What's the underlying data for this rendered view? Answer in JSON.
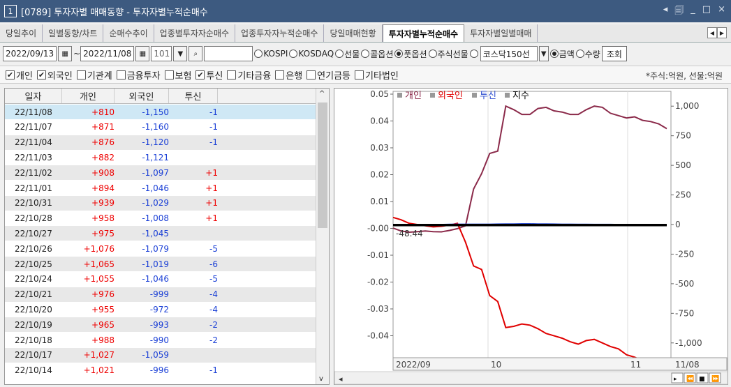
{
  "window": {
    "num": "1",
    "title": "[0789] 투자자별 매매동향 - 투자자별누적순매수",
    "controls": [
      "◂",
      "🗐",
      "_",
      "□",
      "×"
    ]
  },
  "tabs": [
    "당일추이",
    "일별동향/차트",
    "순매수추이",
    "업종별투자자순매수",
    "업종투자자누적순매수",
    "당일매매현황",
    "투자자별누적순매수",
    "투자자별일별매매"
  ],
  "active_tab": 6,
  "toolbar": {
    "date_from": "2022/09/13",
    "sep": "~",
    "date_to": "2022/11/08",
    "code": "101",
    "market_options": [
      "KOSPI",
      "KOSDAQ",
      "선물",
      "콜옵션",
      "풋옵션",
      "주식선물"
    ],
    "selected_market": "풋옵션",
    "index_select": "코스닥150선",
    "unit_options": [
      "금액",
      "수량"
    ],
    "selected_unit": "금액",
    "query_button": "조회"
  },
  "checks": [
    {
      "label": "개인",
      "on": true
    },
    {
      "label": "외국인",
      "on": true
    },
    {
      "label": "기관계",
      "on": false
    },
    {
      "label": "금융투자",
      "on": false
    },
    {
      "label": "보험",
      "on": false
    },
    {
      "label": "투신",
      "on": true
    },
    {
      "label": "기타금융",
      "on": false
    },
    {
      "label": "은행",
      "on": false
    },
    {
      "label": "연기금등",
      "on": false
    },
    {
      "label": "기타법인",
      "on": false
    }
  ],
  "unit_note": "*주식:억원, 선물:억원",
  "table": {
    "headers": [
      "일자",
      "개인",
      "외국인",
      "투신"
    ],
    "rows": [
      [
        "22/11/08",
        "+810",
        "-1,150",
        "-1"
      ],
      [
        "22/11/07",
        "+871",
        "-1,160",
        "-1"
      ],
      [
        "22/11/04",
        "+876",
        "-1,120",
        "-1"
      ],
      [
        "22/11/03",
        "+882",
        "-1,121",
        ""
      ],
      [
        "22/11/02",
        "+908",
        "-1,097",
        "+1"
      ],
      [
        "22/11/01",
        "+894",
        "-1,046",
        "+1"
      ],
      [
        "22/10/31",
        "+939",
        "-1,029",
        "+1"
      ],
      [
        "22/10/28",
        "+958",
        "-1,008",
        "+1"
      ],
      [
        "22/10/27",
        "+975",
        "-1,045",
        ""
      ],
      [
        "22/10/26",
        "+1,076",
        "-1,079",
        "-5"
      ],
      [
        "22/10/25",
        "+1,065",
        "-1,019",
        "-6"
      ],
      [
        "22/10/24",
        "+1,055",
        "-1,046",
        "-5"
      ],
      [
        "22/10/21",
        "+976",
        "-999",
        "-4"
      ],
      [
        "22/10/20",
        "+955",
        "-972",
        "-4"
      ],
      [
        "22/10/19",
        "+965",
        "-993",
        "-2"
      ],
      [
        "22/10/18",
        "+988",
        "-990",
        "-2"
      ],
      [
        "22/10/17",
        "+1,027",
        "-1,059",
        ""
      ],
      [
        "22/10/14",
        "+1,021",
        "-996",
        "-1"
      ]
    ]
  },
  "chart_data": {
    "type": "line",
    "legend": [
      "개인",
      "외국인",
      "투신",
      "지수"
    ],
    "legend_colors": [
      "#8b2a4a",
      "#e00000",
      "#3050d0",
      "#000000"
    ],
    "left_ticks": [
      "0.05",
      "0.04",
      "0.03",
      "0.02",
      "0.01",
      "-0.00",
      "-0.01",
      "-0.02",
      "-0.03",
      "-0.04"
    ],
    "right_ticks": [
      "1,000",
      "750",
      "500",
      "250",
      "0",
      "-250",
      "-500",
      "-750",
      "-1,000"
    ],
    "x_labels": [
      "2022/09",
      "10",
      "11",
      "11/08"
    ],
    "annotation": "-48.44",
    "ylim_right": [
      -1125,
      1125
    ],
    "series": [
      {
        "name": "개인",
        "color": "#8b2a4a",
        "values": [
          -30,
          -55,
          -65,
          -60,
          -55,
          -60,
          -62,
          -50,
          -35,
          -10,
          300,
          430,
          600,
          620,
          1000,
          970,
          930,
          930,
          980,
          990,
          960,
          950,
          930,
          930,
          970,
          1000,
          990,
          940,
          920,
          900,
          910,
          880,
          870,
          850,
          810
        ]
      },
      {
        "name": "외국인",
        "color": "#e00000",
        "values": [
          60,
          40,
          10,
          0,
          -10,
          -20,
          -15,
          -5,
          10,
          -150,
          -350,
          -380,
          -600,
          -650,
          -870,
          -860,
          -840,
          -850,
          -880,
          -920,
          -940,
          -960,
          -990,
          -1010,
          -980,
          -970,
          -1000,
          -1030,
          -1050,
          -1100,
          -1120,
          -1150,
          -1160,
          -1150,
          -1160
        ]
      },
      {
        "name": "투신",
        "color": "#3050d0",
        "values": [
          -5,
          -5,
          -4,
          -3,
          -2,
          0,
          2,
          4,
          5,
          5,
          5,
          5,
          5,
          6,
          7,
          7,
          8,
          8,
          7,
          7,
          6,
          5,
          5,
          4,
          4,
          3,
          3,
          3,
          2,
          2,
          1,
          1,
          0,
          0,
          0
        ]
      },
      {
        "name": "지수",
        "color": "#000000",
        "values": [
          -5,
          -5,
          -5,
          -5,
          -5,
          -5,
          -5,
          -5,
          -5,
          -5,
          -5,
          -5,
          -5,
          -5,
          -5,
          -5,
          -5,
          -5,
          -5,
          -5,
          -5,
          -5,
          -5,
          -5,
          -5,
          -5,
          -5,
          -5,
          -5,
          -5,
          -5,
          -5,
          -5,
          -5,
          -5
        ]
      }
    ]
  }
}
